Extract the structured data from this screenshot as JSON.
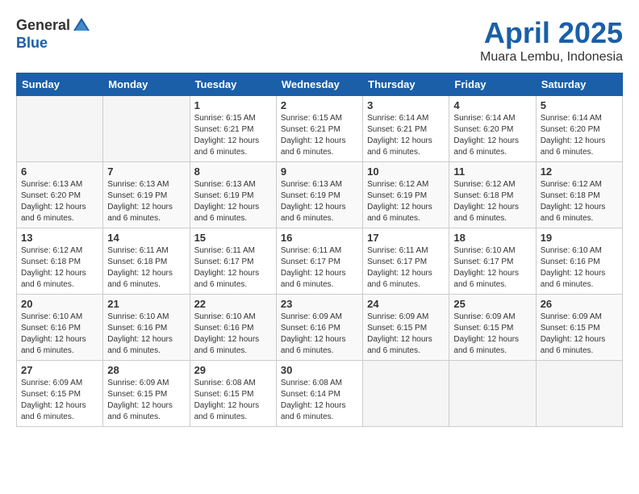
{
  "logo": {
    "general": "General",
    "blue": "Blue"
  },
  "title": {
    "month": "April 2025",
    "location": "Muara Lembu, Indonesia"
  },
  "headers": [
    "Sunday",
    "Monday",
    "Tuesday",
    "Wednesday",
    "Thursday",
    "Friday",
    "Saturday"
  ],
  "weeks": [
    [
      {
        "day": "",
        "info": ""
      },
      {
        "day": "",
        "info": ""
      },
      {
        "day": "1",
        "info": "Sunrise: 6:15 AM\nSunset: 6:21 PM\nDaylight: 12 hours and 6 minutes."
      },
      {
        "day": "2",
        "info": "Sunrise: 6:15 AM\nSunset: 6:21 PM\nDaylight: 12 hours and 6 minutes."
      },
      {
        "day": "3",
        "info": "Sunrise: 6:14 AM\nSunset: 6:21 PM\nDaylight: 12 hours and 6 minutes."
      },
      {
        "day": "4",
        "info": "Sunrise: 6:14 AM\nSunset: 6:20 PM\nDaylight: 12 hours and 6 minutes."
      },
      {
        "day": "5",
        "info": "Sunrise: 6:14 AM\nSunset: 6:20 PM\nDaylight: 12 hours and 6 minutes."
      }
    ],
    [
      {
        "day": "6",
        "info": "Sunrise: 6:13 AM\nSunset: 6:20 PM\nDaylight: 12 hours and 6 minutes."
      },
      {
        "day": "7",
        "info": "Sunrise: 6:13 AM\nSunset: 6:19 PM\nDaylight: 12 hours and 6 minutes."
      },
      {
        "day": "8",
        "info": "Sunrise: 6:13 AM\nSunset: 6:19 PM\nDaylight: 12 hours and 6 minutes."
      },
      {
        "day": "9",
        "info": "Sunrise: 6:13 AM\nSunset: 6:19 PM\nDaylight: 12 hours and 6 minutes."
      },
      {
        "day": "10",
        "info": "Sunrise: 6:12 AM\nSunset: 6:19 PM\nDaylight: 12 hours and 6 minutes."
      },
      {
        "day": "11",
        "info": "Sunrise: 6:12 AM\nSunset: 6:18 PM\nDaylight: 12 hours and 6 minutes."
      },
      {
        "day": "12",
        "info": "Sunrise: 6:12 AM\nSunset: 6:18 PM\nDaylight: 12 hours and 6 minutes."
      }
    ],
    [
      {
        "day": "13",
        "info": "Sunrise: 6:12 AM\nSunset: 6:18 PM\nDaylight: 12 hours and 6 minutes."
      },
      {
        "day": "14",
        "info": "Sunrise: 6:11 AM\nSunset: 6:18 PM\nDaylight: 12 hours and 6 minutes."
      },
      {
        "day": "15",
        "info": "Sunrise: 6:11 AM\nSunset: 6:17 PM\nDaylight: 12 hours and 6 minutes."
      },
      {
        "day": "16",
        "info": "Sunrise: 6:11 AM\nSunset: 6:17 PM\nDaylight: 12 hours and 6 minutes."
      },
      {
        "day": "17",
        "info": "Sunrise: 6:11 AM\nSunset: 6:17 PM\nDaylight: 12 hours and 6 minutes."
      },
      {
        "day": "18",
        "info": "Sunrise: 6:10 AM\nSunset: 6:17 PM\nDaylight: 12 hours and 6 minutes."
      },
      {
        "day": "19",
        "info": "Sunrise: 6:10 AM\nSunset: 6:16 PM\nDaylight: 12 hours and 6 minutes."
      }
    ],
    [
      {
        "day": "20",
        "info": "Sunrise: 6:10 AM\nSunset: 6:16 PM\nDaylight: 12 hours and 6 minutes."
      },
      {
        "day": "21",
        "info": "Sunrise: 6:10 AM\nSunset: 6:16 PM\nDaylight: 12 hours and 6 minutes."
      },
      {
        "day": "22",
        "info": "Sunrise: 6:10 AM\nSunset: 6:16 PM\nDaylight: 12 hours and 6 minutes."
      },
      {
        "day": "23",
        "info": "Sunrise: 6:09 AM\nSunset: 6:16 PM\nDaylight: 12 hours and 6 minutes."
      },
      {
        "day": "24",
        "info": "Sunrise: 6:09 AM\nSunset: 6:15 PM\nDaylight: 12 hours and 6 minutes."
      },
      {
        "day": "25",
        "info": "Sunrise: 6:09 AM\nSunset: 6:15 PM\nDaylight: 12 hours and 6 minutes."
      },
      {
        "day": "26",
        "info": "Sunrise: 6:09 AM\nSunset: 6:15 PM\nDaylight: 12 hours and 6 minutes."
      }
    ],
    [
      {
        "day": "27",
        "info": "Sunrise: 6:09 AM\nSunset: 6:15 PM\nDaylight: 12 hours and 6 minutes."
      },
      {
        "day": "28",
        "info": "Sunrise: 6:09 AM\nSunset: 6:15 PM\nDaylight: 12 hours and 6 minutes."
      },
      {
        "day": "29",
        "info": "Sunrise: 6:08 AM\nSunset: 6:15 PM\nDaylight: 12 hours and 6 minutes."
      },
      {
        "day": "30",
        "info": "Sunrise: 6:08 AM\nSunset: 6:14 PM\nDaylight: 12 hours and 6 minutes."
      },
      {
        "day": "",
        "info": ""
      },
      {
        "day": "",
        "info": ""
      },
      {
        "day": "",
        "info": ""
      }
    ]
  ]
}
